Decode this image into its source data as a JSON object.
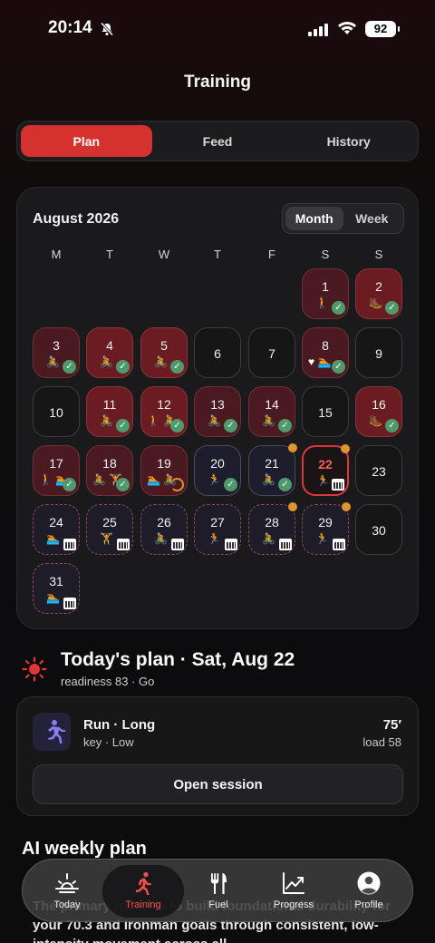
{
  "status_bar": {
    "time": "20:14",
    "battery": "92"
  },
  "header": {
    "title": "Training"
  },
  "tabs": [
    {
      "label": "Plan",
      "active": true
    },
    {
      "label": "Feed",
      "active": false
    },
    {
      "label": "History",
      "active": false
    }
  ],
  "calendar": {
    "month": "August 2026",
    "view_toggle": [
      {
        "label": "Month",
        "active": true
      },
      {
        "label": "Week",
        "active": false
      }
    ],
    "weekdays": [
      "M",
      "T",
      "W",
      "T",
      "F",
      "S",
      "S"
    ],
    "days": [
      {
        "day": "1",
        "sports": "🚶",
        "status": "done",
        "badge": "check"
      },
      {
        "day": "2",
        "sports": "🥾",
        "status": "hard",
        "badge": "check"
      },
      {
        "day": "3",
        "sports": "🚴",
        "status": "done",
        "badge": "check"
      },
      {
        "day": "4",
        "sports": "🚴",
        "status": "hard",
        "badge": "check"
      },
      {
        "day": "5",
        "sports": "🚴",
        "status": "hard",
        "badge": "check"
      },
      {
        "day": "6",
        "sports": "",
        "status": "empty",
        "badge": ""
      },
      {
        "day": "7",
        "sports": "",
        "status": "empty",
        "badge": ""
      },
      {
        "day": "8",
        "sports": "♥ 🏊",
        "status": "done",
        "badge": "check"
      },
      {
        "day": "9",
        "sports": "",
        "status": "empty",
        "badge": ""
      },
      {
        "day": "10",
        "sports": "",
        "status": "empty",
        "badge": ""
      },
      {
        "day": "11",
        "sports": "🚴",
        "status": "hard",
        "badge": "check"
      },
      {
        "day": "12",
        "sports": "🚶 🚴",
        "status": "hard",
        "badge": "check"
      },
      {
        "day": "13",
        "sports": "🚴",
        "status": "done",
        "badge": "check"
      },
      {
        "day": "14",
        "sports": "🚴",
        "status": "done",
        "badge": "check"
      },
      {
        "day": "15",
        "sports": "",
        "status": "empty",
        "badge": ""
      },
      {
        "day": "16",
        "sports": "🥾",
        "status": "hard",
        "badge": "check"
      },
      {
        "day": "17",
        "sports": "🚶 🏊",
        "status": "done",
        "badge": "check"
      },
      {
        "day": "18",
        "sports": "🚴 🏋",
        "status": "done",
        "badge": "check"
      },
      {
        "day": "19",
        "sports": "🏊 🚴",
        "status": "done",
        "badge": "ring"
      },
      {
        "day": "20",
        "sports": "🏃",
        "status": "nav",
        "badge": "check"
      },
      {
        "day": "21",
        "sports": "🚴",
        "status": "nav",
        "badge": "check",
        "dot": true
      },
      {
        "day": "22",
        "sports": "🏃",
        "status": "today",
        "badge": "cal",
        "dot": true
      },
      {
        "day": "23",
        "sports": "",
        "status": "empty",
        "badge": ""
      },
      {
        "day": "24",
        "sports": "🏊",
        "status": "plan",
        "badge": "cal"
      },
      {
        "day": "25",
        "sports": "🏋",
        "status": "plan",
        "badge": "cal"
      },
      {
        "day": "26",
        "sports": "🚴",
        "status": "plan",
        "badge": "cal"
      },
      {
        "day": "27",
        "sports": "🏃",
        "status": "plan",
        "badge": "cal"
      },
      {
        "day": "28",
        "sports": "🚴",
        "status": "plan",
        "badge": "cal",
        "dot": true
      },
      {
        "day": "29",
        "sports": "🏃",
        "status": "plan",
        "badge": "cal",
        "dot": true
      },
      {
        "day": "30",
        "sports": "",
        "status": "empty",
        "badge": ""
      },
      {
        "day": "31",
        "sports": "🏊",
        "status": "plan",
        "badge": "cal"
      }
    ]
  },
  "today": {
    "title": "Today's plan · Sat, Aug 22",
    "subtitle": "readiness 83 · Go",
    "session": {
      "name": "Run · Long",
      "meta": "key · Low",
      "duration": "75′",
      "load": "load 58",
      "button": "Open session"
    }
  },
  "ai": {
    "title": "AI weekly plan",
    "body": "The primary focus is to build foundational durability for your 70.3 and Ironman goals through consistent, low-intensity movement across all"
  },
  "tab_bar": [
    {
      "label": "Today",
      "icon": "sunrise-icon",
      "active": false
    },
    {
      "label": "Training",
      "icon": "runner-icon",
      "active": true
    },
    {
      "label": "Fuel",
      "icon": "fork-knife-icon",
      "active": false
    },
    {
      "label": "Progress",
      "icon": "chart-icon",
      "active": false
    },
    {
      "label": "Profile",
      "icon": "profile-icon",
      "active": false
    }
  ],
  "colors": {
    "accent": "#d5312f",
    "done_check": "#4f9a6c",
    "pending_dot": "#e0932f"
  }
}
